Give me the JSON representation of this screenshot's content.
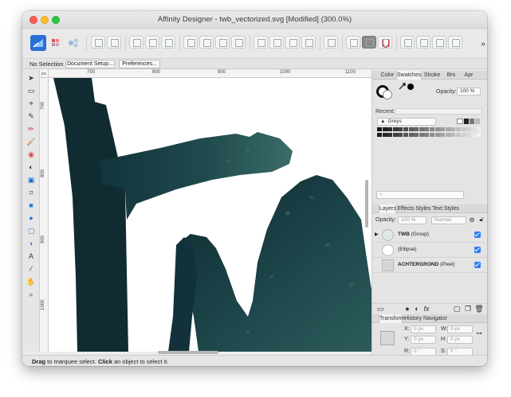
{
  "window": {
    "title": "Affinity Designer - twb_vectorized.svg [Modified] (300.0%)"
  },
  "context_toolbar": {
    "selection_label": "No Selection",
    "document_setup_label": "Document Setup...",
    "preferences_label": "Preferences..."
  },
  "rulers": {
    "unit": "px",
    "horizontal_ticks": [
      "700",
      "800",
      "900",
      "1000",
      "1100"
    ],
    "vertical_ticks": [
      "700",
      "800",
      "900",
      "1000"
    ]
  },
  "canvas": {
    "artwork_text": "twb"
  },
  "status_bar": {
    "action1": "Drag",
    "text1": " to marquee select. ",
    "action2": "Click",
    "text2": " an object to select it."
  },
  "color_panel": {
    "tabs": [
      "Color",
      "Swatches",
      "Stroke",
      "Brs",
      "Apr"
    ],
    "active_tab": "Swatches",
    "opacity_label": "Opacity:",
    "opacity_value": "100 %",
    "recent_label": "Recent:",
    "palette_name": "Greys",
    "search_placeholder": ""
  },
  "layers_panel": {
    "tabs": [
      "Layers",
      "Effects",
      "Styles",
      "Text Styles"
    ],
    "active_tab": "Layers",
    "opacity_label": "Opacity:",
    "opacity_value": "100 %",
    "blend_mode": "Normal",
    "layers": [
      {
        "name": "TWB",
        "type": "(Group)",
        "visible": true
      },
      {
        "name": "",
        "type": "(Ellipse)",
        "visible": true
      },
      {
        "name": "ACHTERGROND",
        "type": "(Pixel)",
        "visible": true
      }
    ]
  },
  "transform_panel": {
    "tabs": [
      "Transform",
      "History",
      "Navigator"
    ],
    "active_tab": "Transform",
    "x_label": "X:",
    "x_value": "0 px",
    "y_label": "Y:",
    "y_value": "0 px",
    "w_label": "W:",
    "w_value": "0 px",
    "h_label": "H:",
    "h_value": "0 px",
    "r_label": "R:",
    "r_value": "0 °",
    "s_label": "S:",
    "s_value": "0 °"
  },
  "colors": {
    "accent": "#2b7cf6",
    "artwork_dark": "#102b31",
    "artwork_teal": "#1f4a4e",
    "artwork_light": "#3c6b68"
  }
}
